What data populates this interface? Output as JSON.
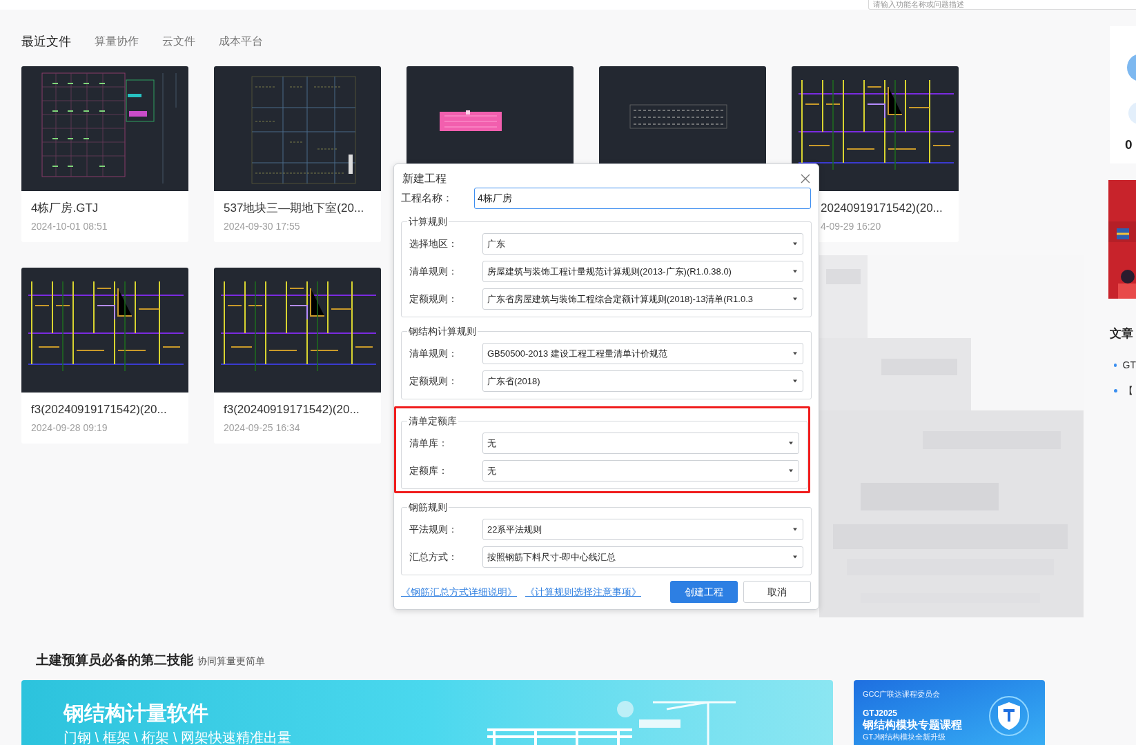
{
  "search": {
    "placeholder": "请输入功能名称或问题描述"
  },
  "tabs": [
    {
      "label": "最近文件",
      "selected": true
    },
    {
      "label": "算量协作",
      "selected": false
    },
    {
      "label": "云文件",
      "selected": false
    },
    {
      "label": "成本平台",
      "selected": false
    }
  ],
  "recent_files": [
    {
      "kind": "file",
      "name": "4栋厂房.GTJ",
      "time": "2024-10-01 08:51"
    },
    {
      "kind": "file",
      "name": "537地块三—期地下室(20...",
      "time": "2024-09-30 17:55"
    },
    {
      "kind": "thumbnail"
    },
    {
      "kind": "thumbnail"
    },
    {
      "kind": "file",
      "name": "20240919171542)(20...",
      "time": "4-09-29 16:20"
    },
    {
      "kind": "file",
      "name": "f3(20240919171542)(20...",
      "time": "2024-09-28 09:19"
    },
    {
      "kind": "file",
      "name": "f3(20240919171542)(20...",
      "time": "2024-09-25 16:34"
    }
  ],
  "dialog": {
    "title": "新建工程",
    "name_label": "工程名称：",
    "name_value": "4栋厂房",
    "groups": [
      {
        "title": "计算规则",
        "highlighted": false,
        "rows": [
          {
            "label": "选择地区：",
            "value": "广东"
          },
          {
            "label": "清单规则：",
            "value": "房屋建筑与装饰工程计量规范计算规则(2013-广东)(R1.0.38.0)"
          },
          {
            "label": "定额规则：",
            "value": "广东省房屋建筑与装饰工程综合定额计算规则(2018)-13清单(R1.0.3"
          }
        ]
      },
      {
        "title": "钢结构计算规则",
        "highlighted": false,
        "rows": [
          {
            "label": "清单规则：",
            "value": "GB50500-2013 建设工程工程量清单计价规范"
          },
          {
            "label": "定额规则：",
            "value": "广东省(2018)"
          }
        ]
      },
      {
        "title": "清单定额库",
        "highlighted": true,
        "rows": [
          {
            "label": "清单库：",
            "value": "无"
          },
          {
            "label": "定额库：",
            "value": "无"
          }
        ]
      },
      {
        "title": "钢筋规则",
        "highlighted": false,
        "rows": [
          {
            "label": "平法规则：",
            "value": "22系平法规则"
          },
          {
            "label": "汇总方式：",
            "value": "按照钢筋下料尺寸-即中心线汇总"
          }
        ]
      }
    ],
    "links": [
      "《钢筋汇总方式详细说明》",
      "《计算规则选择注意事项》"
    ],
    "buttons": [
      {
        "label": "创建工程",
        "kind": "primary"
      },
      {
        "label": "取消",
        "kind": "secondary"
      }
    ]
  },
  "sidebar": {
    "stat": "0",
    "heading": "文章",
    "articles": [
      "GT",
      "【"
    ]
  },
  "promo": {
    "title": "土建预算员必备的第二技能",
    "subtitle": "协同算量更简单",
    "banners": [
      {
        "kind": "wide",
        "title": "钢结构计量软件",
        "subtitle": "门钢 \\ 框架 \\ 桁架 \\ 网架快速精准出量"
      },
      {
        "kind": "course",
        "org": "GCC广联达课程委员会",
        "product": "GTJ2025",
        "title": "钢结构模块专题课程",
        "subtitle": "GTJ钢结构模块全新升级"
      }
    ]
  }
}
